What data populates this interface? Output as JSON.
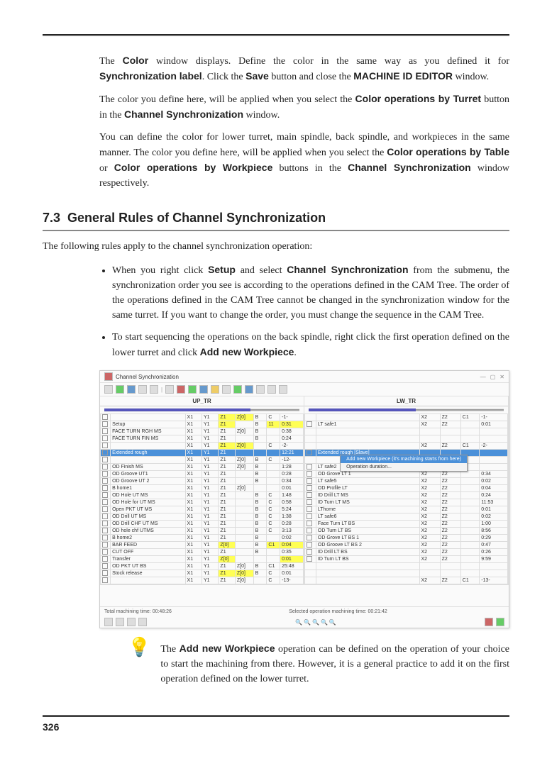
{
  "para1": {
    "t1": "The ",
    "b1": "Color",
    "t2": " window displays. Define the color in the same way as you defined it for ",
    "b2": "Synchronization label",
    "t3": ". Click the ",
    "b3": "Save",
    "t4": " button and close the ",
    "b4": "MACHINE ID EDITOR",
    "t5": " window."
  },
  "para2": {
    "t1": "The color you define here, will be applied when you select the ",
    "b1": "Color operations by Turret",
    "t2": "  button in the ",
    "b2": "Channel Synchronization",
    "t3": " window."
  },
  "para3": {
    "t1": "You can define the color for lower turret, main spindle, back spindle, and workpieces in the same manner. The color you define here, will be applied when you select the ",
    "b1": "Color operations by Table",
    "t2": " or ",
    "b2": "Color operations by Workpiece",
    "t3": "  buttons in the ",
    "b3": "Channel Synchronization",
    "t4": " window respectively."
  },
  "sec": {
    "num": "7.3",
    "title": "General Rules of Channel Synchronization"
  },
  "intro": "The following rules apply to the channel synchronization operation:",
  "bullet1": {
    "t1": "When you right click ",
    "b1": "Setup",
    "t2": " and select ",
    "b2": "Channel Synchronization",
    "t3": " from the submenu, the synchronization order you see is according to the operations defined in the CAM Tree. The order of the operations defined in the CAM Tree cannot be changed in the synchronization window for the same turret. If you want to change the order, you must change the sequence in the CAM Tree."
  },
  "bullet2": {
    "t1": "To start sequencing the operations on the back spindle, right click the first operation defined on the lower turret and click ",
    "b1": "Add new Workpiece",
    "t2": "."
  },
  "shot": {
    "title": "Channel Synchronization",
    "up_col": "UP_TR",
    "lw_col": "LW_TR",
    "headers_up": [
      "",
      "",
      "X1",
      "Y1",
      "Z1",
      "",
      "",
      "C",
      "-1-"
    ],
    "headers_lw": [
      "",
      "",
      "X2",
      "Z2",
      "C1",
      "-1-"
    ],
    "status_left": "Total machining time: 00:48:26",
    "status_right": "Selected operation machining time: 00:21:42",
    "menu_item1": "Add new Workpiece (it's machining starts from here)",
    "menu_item2": "Operation duration...",
    "rows_up": [
      {
        "op": "",
        "x": "X1",
        "y": "Y1",
        "z": "Z1",
        "a": "Z[0]",
        "b": "B",
        "c": "C",
        "t": "-1-",
        "hl": "yellowrow"
      },
      {
        "op": "Setup",
        "x": "X1",
        "y": "Y1",
        "z": "Z1",
        "a": "",
        "b": "B",
        "c": "11",
        "t": "0:31",
        "hl": "yellow"
      },
      {
        "op": "FACE TURN RGH MS",
        "x": "X1",
        "y": "Y1",
        "z": "Z1",
        "a": "Z[0]",
        "b": "B",
        "c": "",
        "t": "0:38"
      },
      {
        "op": "FACE TURN FIN MS",
        "x": "X1",
        "y": "Y1",
        "z": "Z1",
        "a": "",
        "b": "B",
        "c": "",
        "t": "0:24"
      },
      {
        "op": "",
        "x": "X1",
        "y": "Y1",
        "z": "Z1",
        "a": "Z[0]",
        "b": "",
        "c": "C",
        "t": "-2-",
        "hl": "yellowrow"
      },
      {
        "op": "Extended rough",
        "x": "X1",
        "y": "Y1",
        "z": "Z1",
        "a": "",
        "b": "",
        "c": "",
        "t": "12:21",
        "hl": "sel"
      },
      {
        "op": "",
        "x": "X1",
        "y": "Y1",
        "z": "Z1",
        "a": "Z[0]",
        "b": "B",
        "c": "C",
        "t": "-12-"
      },
      {
        "op": "OD Finish MS",
        "x": "X1",
        "y": "Y1",
        "z": "Z1",
        "a": "Z[0]",
        "b": "B",
        "c": "",
        "t": "1:28"
      },
      {
        "op": "OD Groove UT1",
        "x": "X1",
        "y": "Y1",
        "z": "Z1",
        "a": "",
        "b": "B",
        "c": "",
        "t": "0:28"
      },
      {
        "op": "OD Groove UT 2",
        "x": "X1",
        "y": "Y1",
        "z": "Z1",
        "a": "",
        "b": "B",
        "c": "",
        "t": "0:34"
      },
      {
        "op": "B home1",
        "x": "X1",
        "y": "Y1",
        "z": "Z1",
        "a": "Z[0]",
        "b": "",
        "c": "",
        "t": "0:01"
      },
      {
        "op": "OD Hole UT MS",
        "x": "X1",
        "y": "Y1",
        "z": "Z1",
        "a": "",
        "b": "B",
        "c": "C",
        "t": "1:48"
      },
      {
        "op": "OD Hole for UT MS",
        "x": "X1",
        "y": "Y1",
        "z": "Z1",
        "a": "",
        "b": "B",
        "c": "C",
        "t": "0:58"
      },
      {
        "op": "Open PKT UT MS",
        "x": "X1",
        "y": "Y1",
        "z": "Z1",
        "a": "",
        "b": "B",
        "c": "C",
        "t": "5:24"
      },
      {
        "op": "OD Drill UT MS",
        "x": "X1",
        "y": "Y1",
        "z": "Z1",
        "a": "",
        "b": "B",
        "c": "C",
        "t": "1:38"
      },
      {
        "op": "OD Drill CHF UT MS",
        "x": "X1",
        "y": "Y1",
        "z": "Z1",
        "a": "",
        "b": "B",
        "c": "C",
        "t": "0:28"
      },
      {
        "op": "OD hole chf UTMS",
        "x": "X1",
        "y": "Y1",
        "z": "Z1",
        "a": "",
        "b": "B",
        "c": "C",
        "t": "3:13"
      },
      {
        "op": "B home2",
        "x": "X1",
        "y": "Y1",
        "z": "Z1",
        "a": "",
        "b": "B",
        "c": "",
        "t": "0:02"
      },
      {
        "op": "BAR FEED",
        "x": "X1",
        "y": "Y1",
        "z": "Z[0]",
        "a": "",
        "b": "B",
        "c": "C1",
        "t": "0:04",
        "hl": "yellow"
      },
      {
        "op": "CUT OFF",
        "x": "X1",
        "y": "Y1",
        "z": "Z1",
        "a": "",
        "b": "B",
        "c": "",
        "t": "0:35"
      },
      {
        "op": "Transfer",
        "x": "X1",
        "y": "Y1",
        "z": "Z[0]",
        "a": "",
        "b": "",
        "c": "",
        "t": "0:01",
        "hl": "yellow"
      },
      {
        "op": "OD PKT UT BS",
        "x": "X1",
        "y": "Y1",
        "z": "Z1",
        "a": "Z[0]",
        "b": "B",
        "c": "C1",
        "t": "25:48"
      },
      {
        "op": "Stock release",
        "x": "X1",
        "y": "Y1",
        "z": "Z1",
        "a": "Z[0]",
        "b": "B",
        "c": "C",
        "t": "0:01",
        "hl": "yellowrow"
      },
      {
        "op": "",
        "x": "X1",
        "y": "Y1",
        "z": "Z1",
        "a": "Z[0]",
        "b": "",
        "c": "C",
        "t": "-13-"
      }
    ],
    "rows_lw": [
      {
        "op": "",
        "x": "X2",
        "y": "Z2",
        "c": "C1",
        "t": "-1-"
      },
      {
        "op": "LT safe1",
        "x": "X2",
        "y": "Z2",
        "c": "",
        "t": "0:01"
      },
      {
        "op": "",
        "x": "",
        "y": "",
        "c": "",
        "t": ""
      },
      {
        "op": "",
        "x": "",
        "y": "",
        "c": "",
        "t": ""
      },
      {
        "op": "",
        "x": "X2",
        "y": "Z2",
        "c": "C1",
        "t": "-2-"
      },
      {
        "op": "Extended rough [Slave]",
        "x": "",
        "y": "",
        "c": "",
        "t": "",
        "hl": "sel"
      },
      {
        "op": "",
        "x": "",
        "y": "",
        "c": "",
        "t": ""
      },
      {
        "op": "LT safe2",
        "x": "",
        "y": "",
        "c": "",
        "t": ""
      },
      {
        "op": "OD Grove LT 1",
        "x": "X2",
        "y": "Z2",
        "c": "",
        "t": "0:34"
      },
      {
        "op": "LT safe5",
        "x": "X2",
        "y": "Z2",
        "c": "",
        "t": "0:02"
      },
      {
        "op": "OD Profile LT",
        "x": "X2",
        "y": "Z2",
        "c": "",
        "t": "0:04"
      },
      {
        "op": "ID Drill LT MS",
        "x": "X2",
        "y": "Z2",
        "c": "",
        "t": "0:24"
      },
      {
        "op": "ID Turn LT MS",
        "x": "X2",
        "y": "Z2",
        "c": "",
        "t": "11:53"
      },
      {
        "op": "LThome",
        "x": "X2",
        "y": "Z2",
        "c": "",
        "t": "0:01"
      },
      {
        "op": "LT safe6",
        "x": "X2",
        "y": "Z2",
        "c": "",
        "t": "0:02"
      },
      {
        "op": "Face Turn LT BS",
        "x": "X2",
        "y": "Z2",
        "c": "",
        "t": "1:00"
      },
      {
        "op": "OD Turn LT BS",
        "x": "X2",
        "y": "Z2",
        "c": "",
        "t": "8:56"
      },
      {
        "op": "OD Grove LT BS 1",
        "x": "X2",
        "y": "Z2",
        "c": "",
        "t": "0:29"
      },
      {
        "op": "OD Groove LT BS 2",
        "x": "X2",
        "y": "Z2",
        "c": "",
        "t": "0:47"
      },
      {
        "op": "ID Drill LT BS",
        "x": "X2",
        "y": "Z2",
        "c": "",
        "t": "0:26"
      },
      {
        "op": "ID Turn LT BS",
        "x": "X2",
        "y": "Z2",
        "c": "",
        "t": "9:59"
      },
      {
        "op": "",
        "x": "",
        "y": "",
        "c": "",
        "t": ""
      },
      {
        "op": "",
        "x": "",
        "y": "",
        "c": "",
        "t": ""
      },
      {
        "op": "",
        "x": "X2",
        "y": "Z2",
        "c": "C1",
        "t": "-13-"
      }
    ]
  },
  "tip": {
    "t1": "The ",
    "b1": "Add new Workpiece",
    "t2": " operation can be defined on the operation of your choice to start the machining from there. However, it is a general practice to add it on the first operation defined on the lower turret."
  },
  "pagenum": "326"
}
